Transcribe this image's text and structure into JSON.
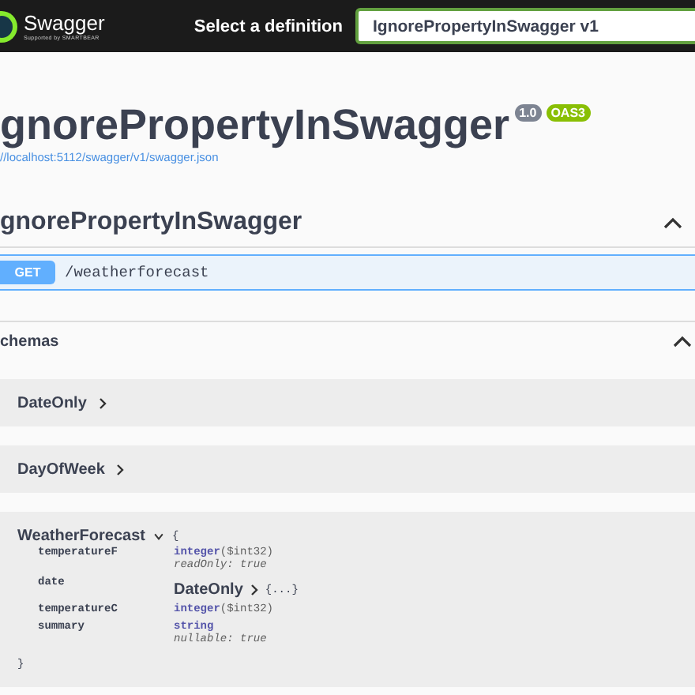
{
  "header": {
    "logo_text": "Swagger",
    "logo_subtext": "Supported by SMARTBEAR",
    "select_label": "Select a definition",
    "select_value": "IgnorePropertyInSwagger v1"
  },
  "info": {
    "title": "gnorePropertyInSwagger",
    "version": "1.0",
    "oas": "OAS3",
    "url": "//localhost:5112/swagger/v1/swagger.json"
  },
  "tags": [
    {
      "name": "gnorePropertyInSwagger",
      "expanded": true,
      "operations": [
        {
          "method": "GET",
          "path": "/weatherforecast"
        }
      ]
    }
  ],
  "schemas": {
    "title": "chemas",
    "expanded": true,
    "models": [
      {
        "name": "DateOnly",
        "expanded": false
      },
      {
        "name": "DayOfWeek",
        "expanded": false
      },
      {
        "name": "WeatherForecast",
        "expanded": true,
        "open_brace": "{",
        "close_brace": "}",
        "properties": [
          {
            "kind": "primitive",
            "name": "temperatureF",
            "type": "integer",
            "format": "($int32)",
            "note": "readOnly: true"
          },
          {
            "kind": "ref",
            "name": "date",
            "ref": "DateOnly",
            "ref_expanded": false,
            "ref_body": "{...}"
          },
          {
            "kind": "primitive",
            "name": "temperatureC",
            "type": "integer",
            "format": "($int32)"
          },
          {
            "kind": "primitive",
            "name": "summary",
            "type": "string",
            "note": "nullable: true"
          }
        ]
      }
    ]
  }
}
